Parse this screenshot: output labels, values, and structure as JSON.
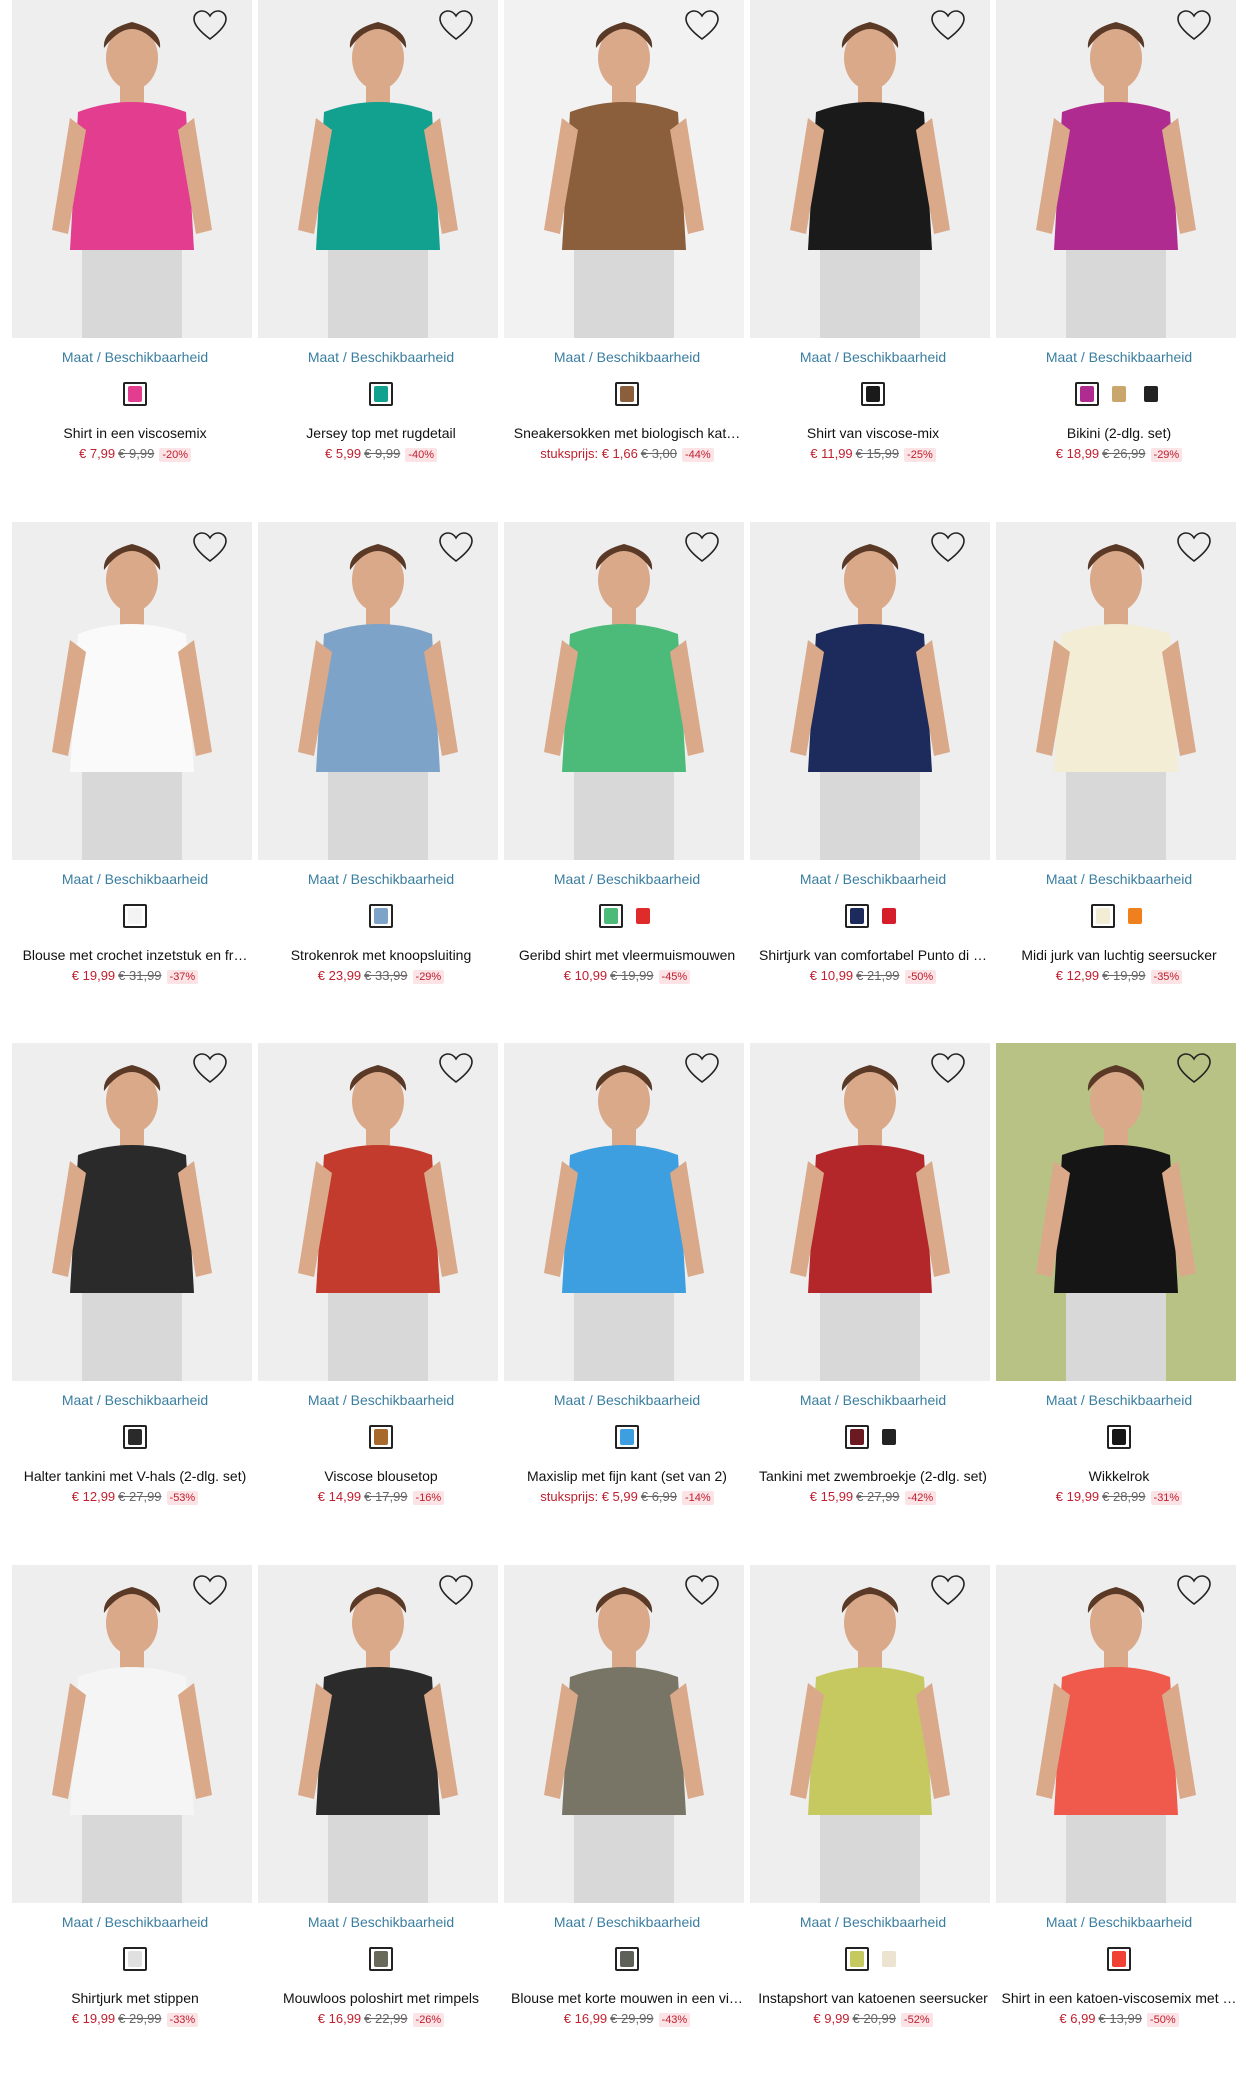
{
  "size_link_label": "Maat / Beschikbaarheid",
  "wishlist_icon": "heart-outline-icon",
  "products": [
    {
      "name": "Shirt in een viscosemix",
      "price": "€ 7,99",
      "old_price": "€ 9,99",
      "discount": "-20%",
      "prefix": "",
      "bg": "#eeeeee",
      "garment": "#e33d8f",
      "swatches": [
        {
          "color": "#e33d8f"
        }
      ]
    },
    {
      "name": "Jersey top met rugdetail",
      "price": "€ 5,99",
      "old_price": "€ 9,99",
      "discount": "-40%",
      "prefix": "",
      "bg": "#eeeeee",
      "garment": "#12a08f",
      "swatches": [
        {
          "color": "#12a08f"
        }
      ]
    },
    {
      "name": "Sneakersokken met biologisch kat…",
      "price": "€ 1,66",
      "old_price": "€ 3,00",
      "discount": "-44%",
      "prefix": "stuksprijs:",
      "bg": "#f2f2f2",
      "garment": "#8b5e3c",
      "swatches": [
        {
          "color": "#8b5e3c"
        }
      ]
    },
    {
      "name": "Shirt van viscose-mix",
      "price": "€ 11,99",
      "old_price": "€ 15,99",
      "discount": "-25%",
      "prefix": "",
      "bg": "#eeeeee",
      "garment": "#1a1a1a",
      "swatches": [
        {
          "color": "#1a1a1a"
        }
      ]
    },
    {
      "name": "Bikini (2-dlg. set)",
      "price": "€ 18,99",
      "old_price": "€ 26,99",
      "discount": "-29%",
      "prefix": "",
      "bg": "#eeeeee",
      "garment": "#b02b8f",
      "swatches": [
        {
          "color": "#b02b8f"
        },
        {
          "color": "#c9a66b"
        },
        {
          "color": "#222222"
        }
      ]
    },
    {
      "name": "Blouse met crochet inzetstuk en fr…",
      "price": "€ 19,99",
      "old_price": "€ 31,99",
      "discount": "-37%",
      "prefix": "",
      "bg": "#eeeeee",
      "garment": "#fafafa",
      "swatches": [
        {
          "color": "#f4f4f4"
        }
      ]
    },
    {
      "name": "Strokenrok met knoopsluiting",
      "price": "€ 23,99",
      "old_price": "€ 33,99",
      "discount": "-29%",
      "prefix": "",
      "bg": "#eeeeee",
      "garment": "#7ea3c9",
      "swatches": [
        {
          "color": "#7ea3c9"
        }
      ]
    },
    {
      "name": "Geribd shirt met vleermuismouwen",
      "price": "€ 10,99",
      "old_price": "€ 19,99",
      "discount": "-45%",
      "prefix": "",
      "bg": "#eeeeee",
      "garment": "#4cbb7a",
      "swatches": [
        {
          "color": "#4cbb7a"
        },
        {
          "color": "#e02b2b"
        }
      ]
    },
    {
      "name": "Shirtjurk van comfortabel Punto di …",
      "price": "€ 10,99",
      "old_price": "€ 21,99",
      "discount": "-50%",
      "prefix": "",
      "bg": "#eeeeee",
      "garment": "#1c2a5c",
      "swatches": [
        {
          "color": "#1c2a5c"
        },
        {
          "color": "#d61e2a"
        }
      ]
    },
    {
      "name": "Midi jurk van luchtig seersucker",
      "price": "€ 12,99",
      "old_price": "€ 19,99",
      "discount": "-35%",
      "prefix": "",
      "bg": "#eeeeee",
      "garment": "#f3edd6",
      "swatches": [
        {
          "color": "#f3edd6"
        },
        {
          "color": "#f07f1e"
        }
      ]
    },
    {
      "name": "Halter tankini met V-hals (2-dlg. set)",
      "price": "€ 12,99",
      "old_price": "€ 27,99",
      "discount": "-53%",
      "prefix": "",
      "bg": "#eeeeee",
      "garment": "#2a2a2a",
      "swatches": [
        {
          "color": "#2a2a2a"
        }
      ]
    },
    {
      "name": "Viscose blousetop",
      "price": "€ 14,99",
      "old_price": "€ 17,99",
      "discount": "-16%",
      "prefix": "",
      "bg": "#eeeeee",
      "garment": "#c23b2c",
      "swatches": [
        {
          "color": "#a86a2c"
        }
      ]
    },
    {
      "name": "Maxislip met fijn kant (set van 2)",
      "price": "€ 5,99",
      "old_price": "€ 6,99",
      "discount": "-14%",
      "prefix": "stuksprijs:",
      "bg": "#eeeeee",
      "garment": "#3d9ee0",
      "swatches": [
        {
          "color": "#3d9ee0"
        }
      ]
    },
    {
      "name": "Tankini met zwembroekje (2-dlg. set)",
      "price": "€ 15,99",
      "old_price": "€ 27,99",
      "discount": "-42%",
      "prefix": "",
      "bg": "#eeeeee",
      "garment": "#b3262a",
      "swatches": [
        {
          "color": "#6b1a22"
        },
        {
          "color": "#222222"
        }
      ]
    },
    {
      "name": "Wikkelrok",
      "price": "€ 19,99",
      "old_price": "€ 28,99",
      "discount": "-31%",
      "prefix": "",
      "bg": "#b9c285",
      "garment": "#151515",
      "swatches": [
        {
          "color": "#151515"
        }
      ]
    },
    {
      "name": "Shirtjurk met stippen",
      "price": "€ 19,99",
      "old_price": "€ 29,99",
      "discount": "-33%",
      "prefix": "",
      "bg": "#eeeeee",
      "garment": "#f5f5f5",
      "swatches": [
        {
          "color": "#e0e0e0"
        }
      ]
    },
    {
      "name": "Mouwloos poloshirt met rimpels",
      "price": "€ 16,99",
      "old_price": "€ 22,99",
      "discount": "-26%",
      "prefix": "",
      "bg": "#eeeeee",
      "garment": "#2b2b2b",
      "swatches": [
        {
          "color": "#6a6a5a"
        }
      ]
    },
    {
      "name": "Blouse met korte mouwen in een vi…",
      "price": "€ 16,99",
      "old_price": "€ 29,99",
      "discount": "-43%",
      "prefix": "",
      "bg": "#eeeeee",
      "garment": "#787566",
      "swatches": [
        {
          "color": "#5e6158"
        }
      ]
    },
    {
      "name": "Instapshort van katoenen seersucker",
      "price": "€ 9,99",
      "old_price": "€ 20,99",
      "discount": "-52%",
      "prefix": "",
      "bg": "#eeeeee",
      "garment": "#c6c960",
      "swatches": [
        {
          "color": "#c6c960"
        },
        {
          "color": "#ece4d0"
        }
      ]
    },
    {
      "name": "Shirt in een katoen-viscosemix met …",
      "price": "€ 6,99",
      "old_price": "€ 13,99",
      "discount": "-50%",
      "prefix": "",
      "bg": "#eeeeee",
      "garment": "#ef5a4c",
      "swatches": [
        {
          "color": "#ef4134"
        }
      ]
    }
  ]
}
